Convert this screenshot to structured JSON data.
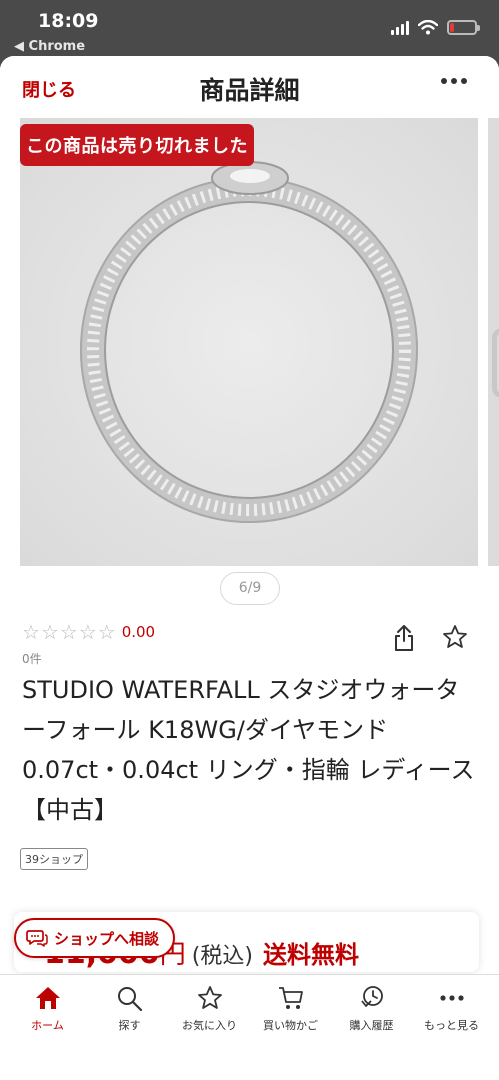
{
  "status_bar": {
    "time": "18:09",
    "back_app": "◀ Chrome",
    "battery_level": 0.15,
    "battery_color": "#e53a3a"
  },
  "header": {
    "close_label": "閉じる",
    "title": "商品詳細",
    "more_icon": "more-dots-icon"
  },
  "gallery": {
    "sold_out_label": "この商品は売り切れました",
    "page_indicator": "6/9"
  },
  "rating": {
    "stars_filled": 0,
    "stars_total": 5,
    "score": "0.00",
    "review_count": "0件"
  },
  "actions": {
    "share_icon": "share-icon",
    "favorite_icon": "star-outline-icon"
  },
  "product": {
    "title": "STUDIO WATERFALL スタジオウォーターフォール K18WG/ダイヤモンド 0.07ct・0.04ct リング・指輪 レディース 【中古】",
    "shop_tag": "39ショップ"
  },
  "price": {
    "value": "11,000",
    "unit": "円",
    "tax": "(税込)",
    "shipping": "送料無料"
  },
  "consult_button": {
    "label": "ショップへ相談"
  },
  "tabbar": {
    "items": [
      {
        "label": "ホーム",
        "icon": "home-icon",
        "active": true
      },
      {
        "label": "探す",
        "icon": "search-icon",
        "active": false
      },
      {
        "label": "お気に入り",
        "icon": "star-icon",
        "active": false
      },
      {
        "label": "買い物かご",
        "icon": "cart-icon",
        "active": false
      },
      {
        "label": "購入履歴",
        "icon": "history-icon",
        "active": false
      },
      {
        "label": "もっと見る",
        "icon": "more-icon",
        "active": false
      }
    ]
  },
  "colors": {
    "accent": "#bf0000",
    "sold_out_bg": "#c4161c"
  }
}
